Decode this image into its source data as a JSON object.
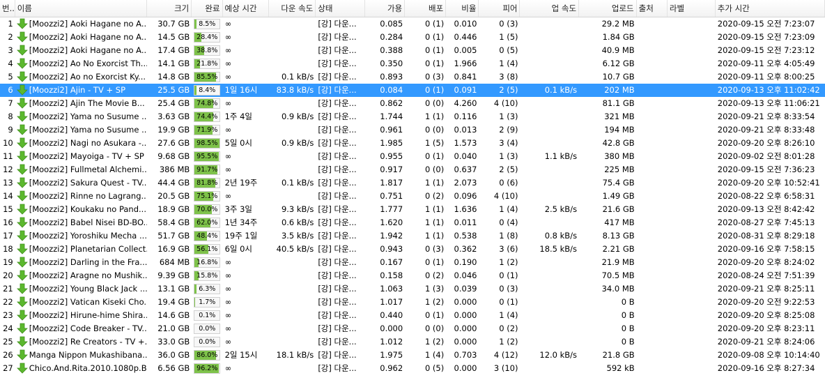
{
  "columns": [
    "#",
    "이름",
    "크기",
    "완료",
    "예상 시간",
    "다운 속도",
    "상태",
    "가용",
    "배포",
    "비율",
    "피어",
    "업 속도",
    "업로드",
    "출처",
    "라벨",
    "추가 시간"
  ],
  "header_num_glyph": "번...",
  "selected_row": 6,
  "colors": {
    "selected": "#3399ff",
    "progress": "#7ec24a",
    "icon": "#5cb82e"
  },
  "row_icon": "download-arrow-icon",
  "rows": [
    {
      "num": "1",
      "name": "[Moozzi2] Aoki Hagane no A...",
      "size": "30.7 GB",
      "done": "8.5%",
      "pct": 8.5,
      "eta": "∞",
      "down": "",
      "status": "[강] 다운...",
      "avail": "0.085",
      "seeds": "0 (1)",
      "ratio": "0.010",
      "peers": "0 (3)",
      "up": "",
      "uploaded": "29.2 MB",
      "source": "",
      "label": "",
      "added": "2020-09-15 오전 7:23:07"
    },
    {
      "num": "2",
      "name": "[Moozzi2] Aoki Hagane no A...",
      "size": "14.5 GB",
      "done": "28.4%",
      "pct": 28.4,
      "eta": "∞",
      "down": "",
      "status": "[강] 다운...",
      "avail": "0.284",
      "seeds": "0 (1)",
      "ratio": "0.446",
      "peers": "1 (5)",
      "up": "",
      "uploaded": "1.84 GB",
      "source": "",
      "label": "",
      "added": "2020-09-15 오전 7:23:09"
    },
    {
      "num": "3",
      "name": "[Moozzi2] Aoki Hagane no A...",
      "size": "17.4 GB",
      "done": "38.8%",
      "pct": 38.8,
      "eta": "∞",
      "down": "",
      "status": "[강] 다운...",
      "avail": "0.388",
      "seeds": "0 (1)",
      "ratio": "0.005",
      "peers": "0 (5)",
      "up": "",
      "uploaded": "40.9 MB",
      "source": "",
      "label": "",
      "added": "2020-09-15 오전 7:23:12"
    },
    {
      "num": "4",
      "name": "[Moozzi2] Ao No Exorcist Th...",
      "size": "14.1 GB",
      "done": "21.8%",
      "pct": 21.8,
      "eta": "∞",
      "down": "",
      "status": "[강] 다운...",
      "avail": "0.350",
      "seeds": "0 (1)",
      "ratio": "1.966",
      "peers": "1 (4)",
      "up": "",
      "uploaded": "6.12 GB",
      "source": "",
      "label": "",
      "added": "2020-09-11 오후 4:05:49"
    },
    {
      "num": "5",
      "name": "[Moozzi2] Ao no Exorcist Ky...",
      "size": "14.8 GB",
      "done": "85.5%",
      "pct": 85.5,
      "eta": "∞",
      "down": "0.1 kB/s",
      "status": "[강] 다운...",
      "avail": "0.893",
      "seeds": "0 (3)",
      "ratio": "0.841",
      "peers": "3 (8)",
      "up": "",
      "uploaded": "10.7 GB",
      "source": "",
      "label": "",
      "added": "2020-09-11 오후 8:00:25"
    },
    {
      "num": "6",
      "name": "[Moozzi2] Ajin - TV + SP",
      "size": "25.5 GB",
      "done": "8.4%",
      "pct": 8.4,
      "eta": "1일 16시",
      "down": "83.8 kB/s",
      "status": "[강] 다운...",
      "avail": "0.084",
      "seeds": "0 (1)",
      "ratio": "0.091",
      "peers": "2 (5)",
      "up": "0.1 kB/s",
      "uploaded": "202 MB",
      "source": "",
      "label": "",
      "added": "2020-09-13 오후 11:02:42"
    },
    {
      "num": "7",
      "name": "[Moozzi2] Ajin The Movie B...",
      "size": "25.4 GB",
      "done": "74.8%",
      "pct": 74.8,
      "eta": "∞",
      "down": "",
      "status": "[강] 다운...",
      "avail": "0.862",
      "seeds": "0 (0)",
      "ratio": "4.260",
      "peers": "4 (10)",
      "up": "",
      "uploaded": "81.1 GB",
      "source": "",
      "label": "",
      "added": "2020-09-13 오후 11:06:21"
    },
    {
      "num": "8",
      "name": "[Moozzi2] Yama no Susume ...",
      "size": "3.63 GB",
      "done": "74.4%",
      "pct": 74.4,
      "eta": "1주 4일",
      "down": "0.9 kB/s",
      "status": "[강] 다운...",
      "avail": "1.744",
      "seeds": "1 (1)",
      "ratio": "0.116",
      "peers": "1 (3)",
      "up": "",
      "uploaded": "321 MB",
      "source": "",
      "label": "",
      "added": "2020-09-21 오후 8:33:54"
    },
    {
      "num": "9",
      "name": "[Moozzi2] Yama no Susume ...",
      "size": "19.9 GB",
      "done": "71.9%",
      "pct": 71.9,
      "eta": "∞",
      "down": "",
      "status": "[강] 다운...",
      "avail": "0.961",
      "seeds": "0 (0)",
      "ratio": "0.013",
      "peers": "2 (9)",
      "up": "",
      "uploaded": "194 MB",
      "source": "",
      "label": "",
      "added": "2020-09-21 오후 8:33:48"
    },
    {
      "num": "10",
      "name": "[Moozzi2] Nagi no Asukara -...",
      "size": "27.6 GB",
      "done": "98.5%",
      "pct": 98.5,
      "eta": "5일 0시",
      "down": "0.9 kB/s",
      "status": "[강] 다운...",
      "avail": "1.985",
      "seeds": "1 (5)",
      "ratio": "1.573",
      "peers": "3 (4)",
      "up": "",
      "uploaded": "42.8 GB",
      "source": "",
      "label": "",
      "added": "2020-09-20 오후 8:26:10"
    },
    {
      "num": "11",
      "name": "[Moozzi2] Mayoiga - TV + SP",
      "size": "9.68 GB",
      "done": "95.5%",
      "pct": 95.5,
      "eta": "∞",
      "down": "",
      "status": "[강] 다운...",
      "avail": "0.955",
      "seeds": "0 (1)",
      "ratio": "0.040",
      "peers": "1 (3)",
      "up": "1.1 kB/s",
      "uploaded": "380 MB",
      "source": "",
      "label": "",
      "added": "2020-09-02 오전 8:01:28"
    },
    {
      "num": "12",
      "name": "[Moozzi2] Fullmetal Alchemi...",
      "size": "386 MB",
      "done": "91.7%",
      "pct": 91.7,
      "eta": "∞",
      "down": "",
      "status": "[강] 다운...",
      "avail": "0.917",
      "seeds": "0 (0)",
      "ratio": "0.637",
      "peers": "2 (5)",
      "up": "",
      "uploaded": "225 MB",
      "source": "",
      "label": "",
      "added": "2020-09-15 오전 7:36:23"
    },
    {
      "num": "13",
      "name": "[Moozzi2] Sakura Quest - TV...",
      "size": "44.4 GB",
      "done": "81.8%",
      "pct": 81.8,
      "eta": "2년 19주",
      "down": "0.1 kB/s",
      "status": "[강] 다운...",
      "avail": "1.817",
      "seeds": "1 (1)",
      "ratio": "2.073",
      "peers": "0 (6)",
      "up": "",
      "uploaded": "75.4 GB",
      "source": "",
      "label": "",
      "added": "2020-09-20 오후 10:52:41"
    },
    {
      "num": "14",
      "name": "[Moozzi2] Rinne no Lagrang...",
      "size": "20.5 GB",
      "done": "75.1%",
      "pct": 75.1,
      "eta": "∞",
      "down": "",
      "status": "[강] 다운...",
      "avail": "0.751",
      "seeds": "0 (2)",
      "ratio": "0.096",
      "peers": "4 (10)",
      "up": "",
      "uploaded": "1.49 GB",
      "source": "",
      "label": "",
      "added": "2020-08-22 오후 6:58:31"
    },
    {
      "num": "15",
      "name": "[Moozzi2] Koukaku no Pand...",
      "size": "18.9 GB",
      "done": "70.0%",
      "pct": 70.0,
      "eta": "3주 3일",
      "down": "9.3 kB/s",
      "status": "[강] 다운...",
      "avail": "1.777",
      "seeds": "1 (1)",
      "ratio": "1.636",
      "peers": "1 (4)",
      "up": "2.5 kB/s",
      "uploaded": "21.6 GB",
      "source": "",
      "label": "",
      "added": "2020-09-13 오전 8:42:42"
    },
    {
      "num": "16",
      "name": "[Moozzi2] Babel Nisei BD-BO...",
      "size": "58.4 GB",
      "done": "62.0%",
      "pct": 62.0,
      "eta": "1년 34주",
      "down": "0.6 kB/s",
      "status": "[강] 다운...",
      "avail": "1.620",
      "seeds": "1 (1)",
      "ratio": "0.011",
      "peers": "0 (4)",
      "up": "",
      "uploaded": "417 MB",
      "source": "",
      "label": "",
      "added": "2020-08-27 오후 7:45:13"
    },
    {
      "num": "17",
      "name": "[Moozzi2] Yoroshiku Mecha ...",
      "size": "51.7 GB",
      "done": "48.4%",
      "pct": 48.4,
      "eta": "19주 1일",
      "down": "3.5 kB/s",
      "status": "[강] 다운...",
      "avail": "1.942",
      "seeds": "1 (1)",
      "ratio": "0.538",
      "peers": "1 (8)",
      "up": "0.8 kB/s",
      "uploaded": "8.13 GB",
      "source": "",
      "label": "",
      "added": "2020-08-31 오후 8:29:18"
    },
    {
      "num": "18",
      "name": "[Moozzi2] Planetarian Collect...",
      "size": "16.9 GB",
      "done": "56.1%",
      "pct": 56.1,
      "eta": "6일 0시",
      "down": "40.5 kB/s",
      "status": "[강] 다운...",
      "avail": "0.943",
      "seeds": "0 (3)",
      "ratio": "0.362",
      "peers": "3 (6)",
      "up": "18.5 kB/s",
      "uploaded": "2.21 GB",
      "source": "",
      "label": "",
      "added": "2020-09-16 오후 7:58:15"
    },
    {
      "num": "19",
      "name": "[Moozzi2] Darling in the Fra...",
      "size": "684 MB",
      "done": "16.8%",
      "pct": 16.8,
      "eta": "∞",
      "down": "",
      "status": "[강] 다운...",
      "avail": "0.167",
      "seeds": "0 (1)",
      "ratio": "0.190",
      "peers": "1 (2)",
      "up": "",
      "uploaded": "21.9 MB",
      "source": "",
      "label": "",
      "added": "2020-09-20 오후 8:24:02"
    },
    {
      "num": "20",
      "name": "[Moozzi2] Aragne no Mushik...",
      "size": "9.39 GB",
      "done": "15.8%",
      "pct": 15.8,
      "eta": "∞",
      "down": "",
      "status": "[강] 다운...",
      "avail": "0.158",
      "seeds": "0 (2)",
      "ratio": "0.046",
      "peers": "0 (1)",
      "up": "",
      "uploaded": "70.5 MB",
      "source": "",
      "label": "",
      "added": "2020-08-24 오전 7:51:39"
    },
    {
      "num": "21",
      "name": "[Moozzi2] Young Black Jack ...",
      "size": "13.1 GB",
      "done": "6.3%",
      "pct": 6.3,
      "eta": "∞",
      "down": "",
      "status": "[강] 다운...",
      "avail": "1.063",
      "seeds": "1 (3)",
      "ratio": "0.039",
      "peers": "0 (3)",
      "up": "",
      "uploaded": "34.0 MB",
      "source": "",
      "label": "",
      "added": "2020-09-21 오후 8:25:11"
    },
    {
      "num": "22",
      "name": "[Moozzi2] Vatican Kiseki Cho...",
      "size": "19.4 GB",
      "done": "1.7%",
      "pct": 1.7,
      "eta": "∞",
      "down": "",
      "status": "[강] 다운...",
      "avail": "1.017",
      "seeds": "1 (2)",
      "ratio": "0.000",
      "peers": "0 (1)",
      "up": "",
      "uploaded": "0 B",
      "source": "",
      "label": "",
      "added": "2020-09-20 오전 9:22:53"
    },
    {
      "num": "23",
      "name": "[Moozzi2] Hirune-hime Shira...",
      "size": "14.6 GB",
      "done": "0.1%",
      "pct": 0.1,
      "eta": "∞",
      "down": "",
      "status": "[강] 다운...",
      "avail": "0.440",
      "seeds": "0 (1)",
      "ratio": "0.000",
      "peers": "1 (4)",
      "up": "",
      "uploaded": "0 B",
      "source": "",
      "label": "",
      "added": "2020-09-20 오후 8:25:08"
    },
    {
      "num": "24",
      "name": "[Moozzi2] Code Breaker - TV...",
      "size": "21.0 GB",
      "done": "0.0%",
      "pct": 0.0,
      "eta": "∞",
      "down": "",
      "status": "[강] 다운...",
      "avail": "0.000",
      "seeds": "0 (0)",
      "ratio": "0.000",
      "peers": "0 (2)",
      "up": "",
      "uploaded": "0 B",
      "source": "",
      "label": "",
      "added": "2020-09-20 오후 8:23:11"
    },
    {
      "num": "25",
      "name": "[Moozzi2] Re Creators - TV +...",
      "size": "33.0 GB",
      "done": "0.0%",
      "pct": 0.0,
      "eta": "∞",
      "down": "",
      "status": "[강] 다운...",
      "avail": "1.012",
      "seeds": "1 (2)",
      "ratio": "0.000",
      "peers": "1 (2)",
      "up": "",
      "uploaded": "0 B",
      "source": "",
      "label": "",
      "added": "2020-09-21 오후 8:24:06"
    },
    {
      "num": "26",
      "name": "Manga Nippon Mukashibana...",
      "size": "36.0 GB",
      "done": "86.0%",
      "pct": 86.0,
      "eta": "2일 15시",
      "down": "18.1 kB/s",
      "status": "[강] 다운...",
      "avail": "1.975",
      "seeds": "1 (4)",
      "ratio": "0.703",
      "peers": "4 (12)",
      "up": "12.0 kB/s",
      "uploaded": "21.8 GB",
      "source": "",
      "label": "",
      "added": "2020-09-08 오후 10:14:40"
    },
    {
      "num": "27",
      "name": "Chico.And.Rita.2010.1080p.B...",
      "size": "6.56 GB",
      "done": "96.2%",
      "pct": 96.2,
      "eta": "∞",
      "down": "",
      "status": "[강] 다운...",
      "avail": "0.962",
      "seeds": "0 (5)",
      "ratio": "0.000",
      "peers": "3 (10)",
      "up": "",
      "uploaded": "592 kB",
      "source": "",
      "label": "",
      "added": "2020-09-16 오후 8:27:34"
    }
  ]
}
